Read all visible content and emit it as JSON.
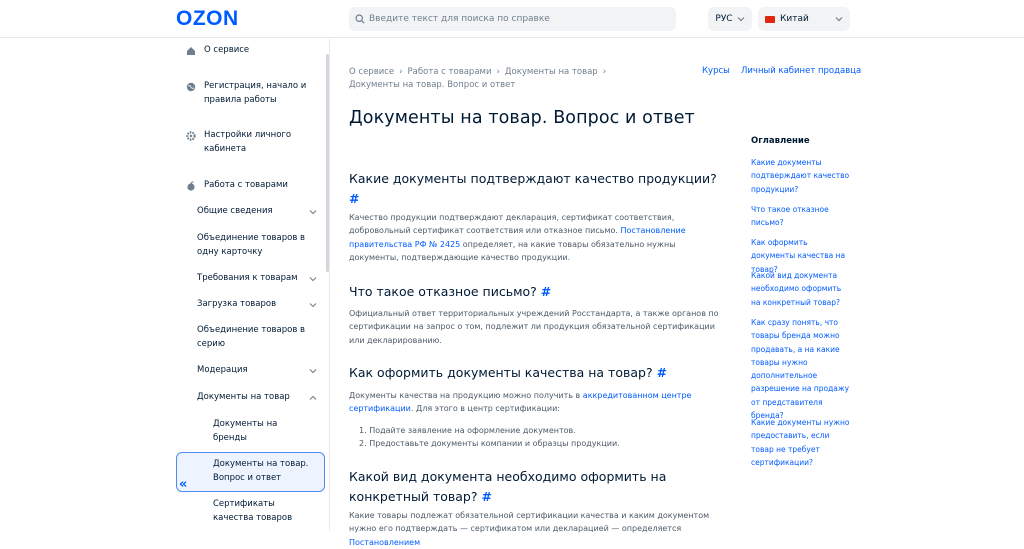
{
  "header": {
    "logo": "OZON",
    "search_placeholder": "Введите текст для поиска по справке",
    "language": "РУС",
    "country": "Китай"
  },
  "sidebar": {
    "top_items": [
      {
        "label": "О сервисе",
        "icon": "home-icon"
      },
      {
        "label": "Регистрация, начало и правила работы",
        "icon": "globe-icon"
      },
      {
        "label": "Настройки личного кабинета",
        "icon": "gear-icon"
      },
      {
        "label": "Работа с товарами",
        "icon": "apple-icon"
      }
    ],
    "sub_items": [
      "Общие сведения",
      "Объединение товаров в одну карточку",
      "Требования к товарам",
      "Загрузка товаров",
      "Объединение товаров в серию",
      "Модерация",
      "Документы на товар"
    ],
    "sub_sub_items": [
      "Документы на бренды",
      "Документы на товар. Вопрос и ответ",
      "Сертификаты качества товаров"
    ]
  },
  "breadcrumb": [
    "О сервисе",
    "Работа с товарами",
    "Документы на товар",
    "Документы на товар. Вопрос и ответ"
  ],
  "top_links": [
    "Курсы",
    "Личный кабинет продавца"
  ],
  "page_title": "Документы на товар. Вопрос и ответ",
  "sections": [
    {
      "heading": "Какие документы подтверждают качество продукции?",
      "text_before": "Качество продукции подтверждают декларация, сертификат соответствия, добровольный сертификат соответствия или отказное письмо. ",
      "link": "Постановление правительства РФ № 2425",
      "text_after": " определяет, на какие товары обязательно нужны документы, подтверждающие качество продукции."
    },
    {
      "heading": "Что такое отказное письмо?",
      "text": "Официальный ответ территориальных учреждений Росстандарта, а также органов по сертификации на запрос о том, подлежит ли продукция обязательной сертификации или декларированию."
    },
    {
      "heading": "Как оформить документы качества на товар?",
      "text_before": "Документы качества на продукцию можно получить в ",
      "link": "аккредитованном центре сертификации",
      "text_after": ". Для этого в центр сертификации:",
      "list": [
        "Подайте заявление на оформление документов.",
        "Предоставьте документы компании и образцы продукции."
      ]
    },
    {
      "heading": "Какой вид документа необходимо оформить на конкретный товар?",
      "text_before": "Какие товары подлежат обязательной сертификации качества и каким документом нужно его подтверждать — сертификатом или декларацией — определяется ",
      "link": "Постановлением"
    }
  ],
  "hash": "#",
  "toc": {
    "title": "Оглавление",
    "items": [
      "Какие документы подтверждают качество продукции?",
      "Что такое отказное письмо?",
      "Как оформить документы качества на товар?",
      "Какой вид документа необходимо оформить на конкретный товар?",
      "Как сразу понять, что товары бренда можно продавать, а на какие товары нужно дополнительное разрешение на продажу от представителя бренда?",
      "Какие документы нужно предоставить, если товар не требует сертификации?"
    ]
  },
  "colors": {
    "accent": "#005bff",
    "text": "#001a34",
    "muted": "#707f8d"
  }
}
